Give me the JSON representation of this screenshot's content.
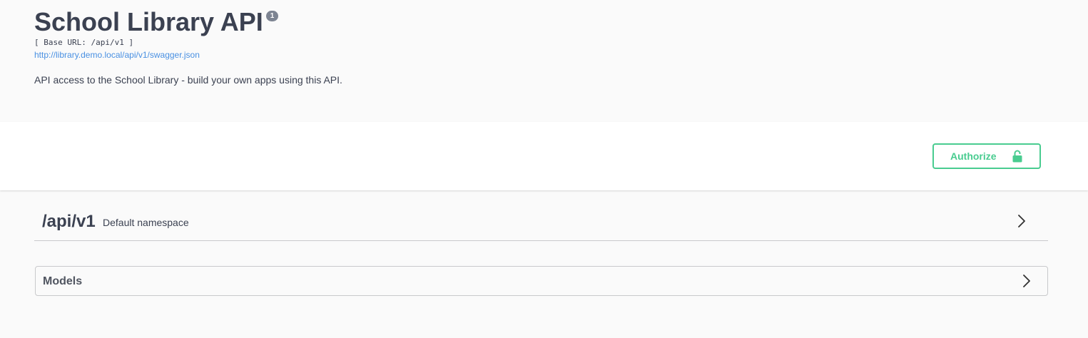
{
  "info": {
    "title": "School Library API",
    "version_badge": "1",
    "base_url": "[ Base URL: /api/v1 ]",
    "swagger_link": "http://library.demo.local/api/v1/swagger.json",
    "description": "API access to the School Library - build your own apps using this API."
  },
  "auth": {
    "authorize_label": "Authorize",
    "icon": "unlock-icon"
  },
  "tags": [
    {
      "name": "/api/v1",
      "description": "Default namespace",
      "icon": "chevron-right-icon"
    }
  ],
  "models": {
    "title": "Models",
    "icon": "chevron-right-icon"
  },
  "colors": {
    "accent_green": "#49cc90",
    "link_blue": "#4990e2",
    "text": "#3b4151",
    "badge": "#7d8492"
  }
}
